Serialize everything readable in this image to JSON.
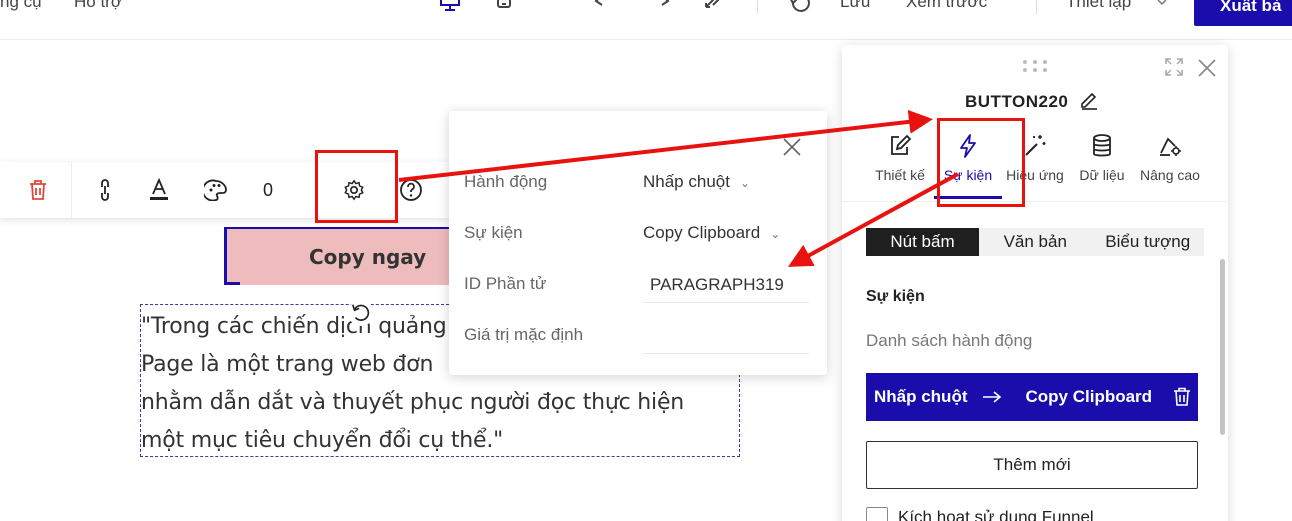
{
  "topbar": {
    "menu_tools": "ng cụ",
    "menu_help": "Hỗ trợ",
    "save": "Lưu",
    "preview": "Xem trước",
    "settings": "Thiết lập",
    "export": "Xuất bả",
    "icons": [
      "desktop-icon",
      "mobile-icon",
      "undo-icon",
      "redo-icon",
      "fullscreen-icon",
      "history-icon",
      "chevron-down-icon"
    ]
  },
  "element_toolbar": {
    "icons": [
      "trash-icon",
      "link-icon",
      "text-format-icon",
      "palette-icon",
      "gear-icon",
      "help-icon"
    ],
    "count": "0"
  },
  "canvas": {
    "button_text": "Copy ngay",
    "paragraph_lines": [
      "\"Trong các chiến dịch quảng",
      "Page là một trang web đơn",
      "nhằm dẫn dắt và thuyết phục người đọc thực hiện",
      "một mục tiêu chuyển đổi cụ thể.\""
    ]
  },
  "settings_popup": {
    "rows": [
      {
        "label": "Hành động",
        "value": "Nhấp chuột",
        "dropdown": true
      },
      {
        "label": "Sự kiện",
        "value": "Copy Clipboard",
        "dropdown": true
      },
      {
        "label": "ID Phần tử",
        "value": "PARAGRAPH319",
        "dropdown": false
      },
      {
        "label": "Giá trị mặc định",
        "value": "",
        "dropdown": false
      }
    ]
  },
  "panel": {
    "title": "BUTTON220",
    "tabs": [
      {
        "label": "Thiết kế",
        "icon": "pencil-square-icon"
      },
      {
        "label": "Sự kiện",
        "icon": "lightning-icon",
        "active": true
      },
      {
        "label": "Hiệu ứng",
        "icon": "magic-wand-icon"
      },
      {
        "label": "Dữ liệu",
        "icon": "database-icon"
      },
      {
        "label": "Nâng cao",
        "icon": "advanced-settings-icon"
      }
    ],
    "segments": [
      "Nút bấm",
      "Văn bản",
      "Biểu tượng"
    ],
    "section_title": "Sự kiện",
    "action_list_label": "Danh sách hành động",
    "action": {
      "trigger": "Nhấp chuột",
      "event": "Copy Clipboard"
    },
    "add_button": "Thêm mới",
    "funnel_label": "Kích hoạt sử dụng Funnel"
  },
  "colors": {
    "brand": "#1a0dab",
    "highlight": "#e8130f",
    "button_bg": "#eebcbc",
    "trash": "#e0483a"
  }
}
